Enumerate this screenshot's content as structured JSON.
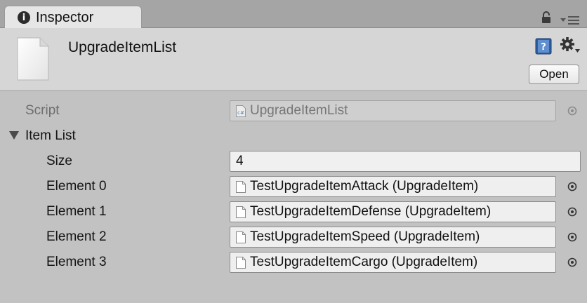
{
  "tab": {
    "title": "Inspector"
  },
  "header": {
    "asset_name": "UpgradeItemList",
    "open_label": "Open"
  },
  "properties": {
    "script": {
      "label": "Script",
      "value": "UpgradeItemList"
    },
    "item_list": {
      "label": "Item List",
      "expanded": true,
      "size_label": "Size",
      "size_value": "4",
      "elements": [
        {
          "label": "Element 0",
          "value": "TestUpgradeItemAttack (UpgradeItem)"
        },
        {
          "label": "Element 1",
          "value": "TestUpgradeItemDefense (UpgradeItem)"
        },
        {
          "label": "Element 2",
          "value": "TestUpgradeItemSpeed (UpgradeItem)"
        },
        {
          "label": "Element 3",
          "value": "TestUpgradeItemCargo (UpgradeItem)"
        }
      ]
    }
  },
  "icons": {
    "tab": "info-icon",
    "lock": "lock-icon",
    "menu": "panel-menu-icon",
    "asset": "scriptable-object-icon",
    "help": "help-book-icon",
    "settings": "gear-icon",
    "picker": "object-picker-icon",
    "foldout": "foldout-arrow-icon"
  },
  "colors": {
    "background": "#c2c2c2",
    "header": "#d6d6d6",
    "tab_active": "#e6e6e6",
    "tab_bar": "#a5a5a5"
  }
}
